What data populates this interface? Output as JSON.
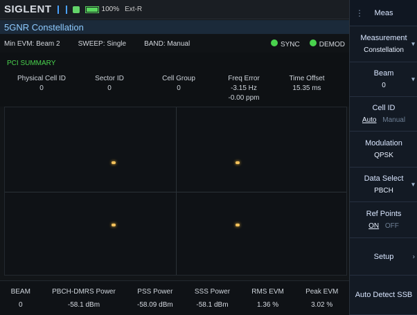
{
  "topbar": {
    "brand": "SIGLENT",
    "battery_percent": "100%",
    "battery_level": 1.0,
    "ext": "Ext-R",
    "icons": [
      "usb-icon",
      "network-icon",
      "battery-icon"
    ]
  },
  "title": "5GNR Constellation",
  "info": {
    "min_evm": "Min EVM: Beam 2",
    "sweep": "SWEEP: Single",
    "band": "BAND: Manual",
    "sync_label": "SYNC",
    "demod_label": "DEMOD",
    "status_color": "#49d24d"
  },
  "pci": {
    "title": "PCI SUMMARY",
    "columns": [
      {
        "label": "Physical Cell ID",
        "value": "0",
        "value2": ""
      },
      {
        "label": "Sector ID",
        "value": "0",
        "value2": ""
      },
      {
        "label": "Cell Group",
        "value": "0",
        "value2": ""
      },
      {
        "label": "Freq Error",
        "value": "-3.15 Hz",
        "value2": "-0.00 ppm"
      },
      {
        "label": "Time Offset",
        "value": "15.35 ms",
        "value2": ""
      }
    ]
  },
  "bottom": {
    "columns": [
      {
        "label": "BEAM",
        "value": "0"
      },
      {
        "label": "PBCH-DMRS Power",
        "value": "-58.1 dBm"
      },
      {
        "label": "PSS Power",
        "value": "-58.09 dBm"
      },
      {
        "label": "SSS Power",
        "value": "-58.1 dBm"
      },
      {
        "label": "RMS EVM",
        "value": "1.36 %"
      },
      {
        "label": "Peak EVM",
        "value": "3.02 %"
      }
    ]
  },
  "menu": {
    "header": "Meas",
    "measurement": {
      "label": "Measurement",
      "value": "Constellation"
    },
    "beam": {
      "label": "Beam",
      "value": "0"
    },
    "cell_id": {
      "label": "Cell ID",
      "active": "Auto",
      "inactive": "Manual"
    },
    "modulation": {
      "label": "Modulation",
      "value": "QPSK"
    },
    "data_select": {
      "label": "Data Select",
      "value": "PBCH"
    },
    "ref_points": {
      "label": "Ref Points",
      "active": "ON",
      "inactive": "OFF"
    },
    "setup": {
      "label": "Setup"
    },
    "auto_detect": {
      "label": "Auto Detect SSB"
    }
  }
}
